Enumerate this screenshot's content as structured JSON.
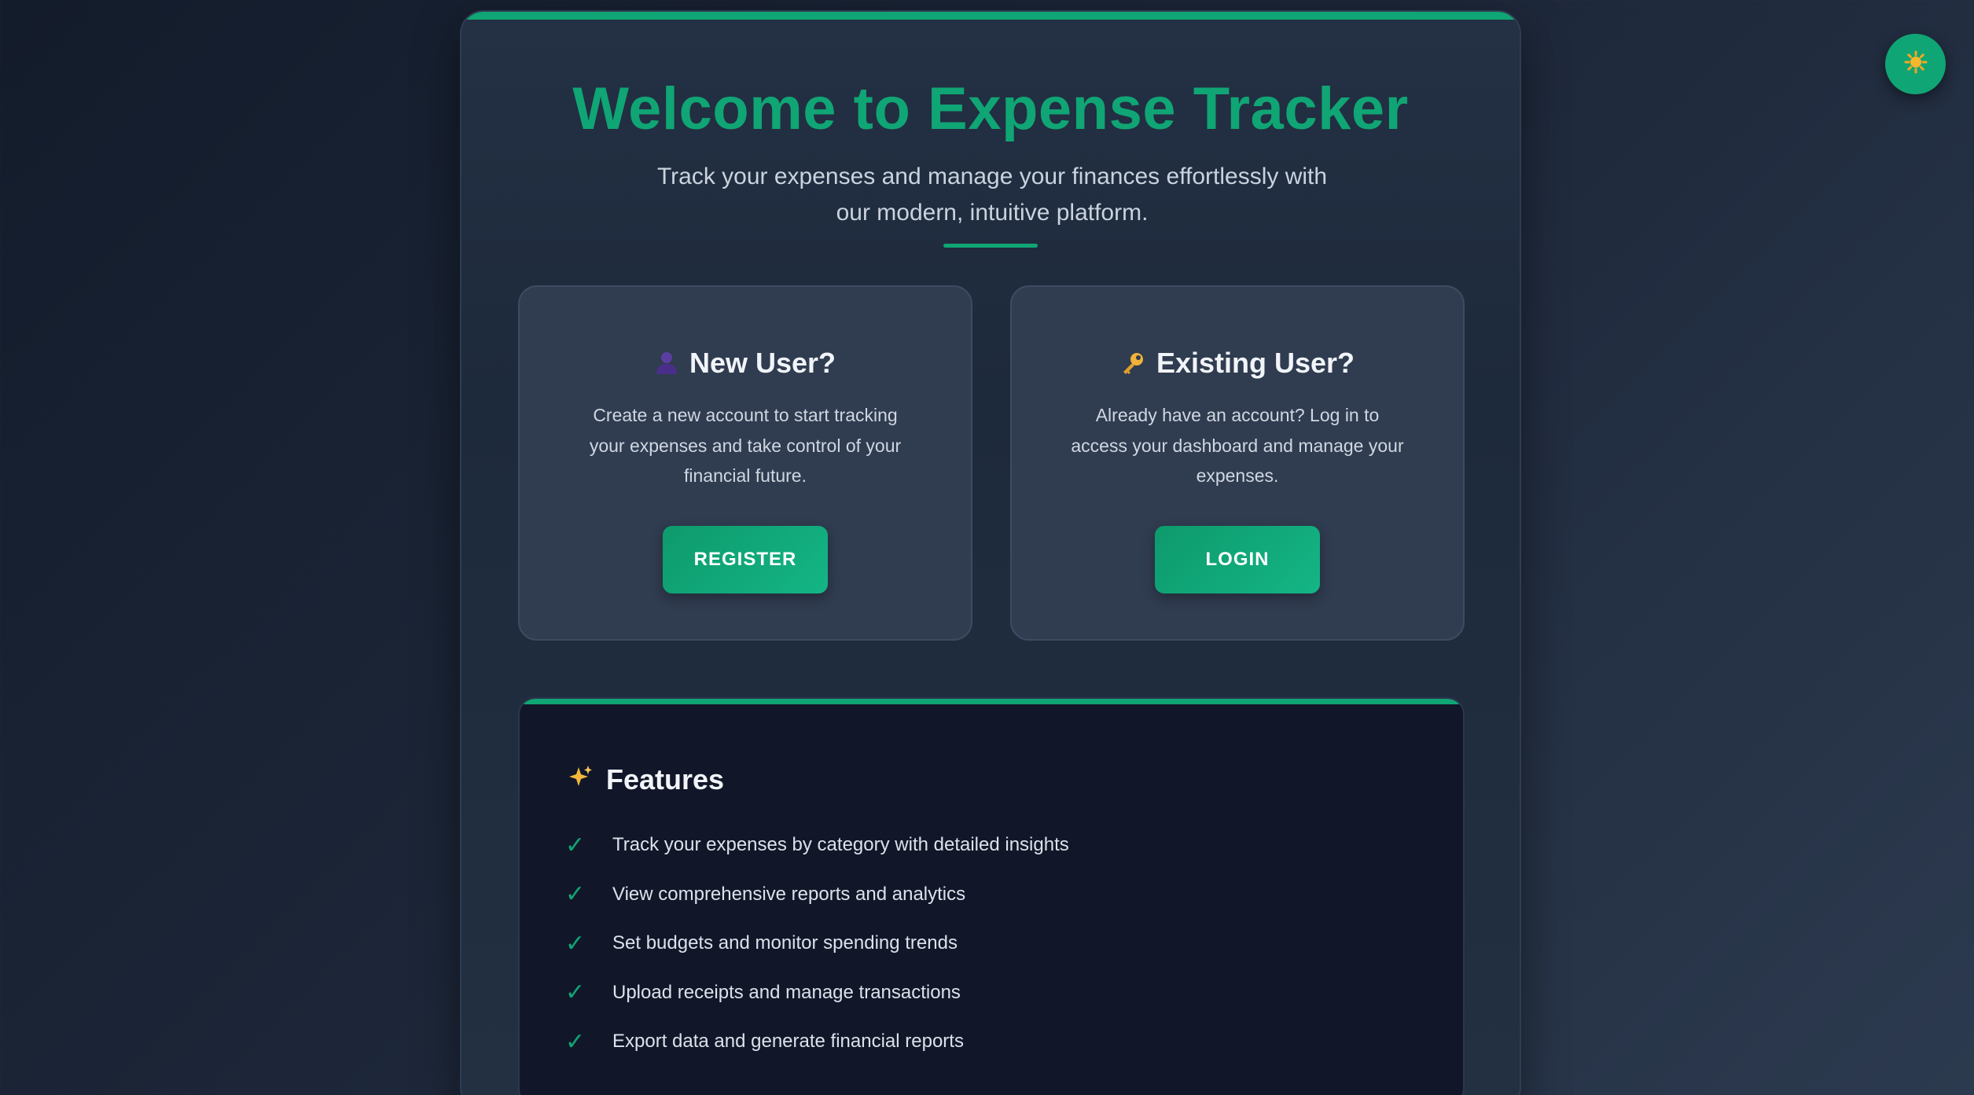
{
  "page": {
    "title": "Welcome to Expense Tracker",
    "subtitle": "Track your expenses and manage your finances effortlessly with our modern, intuitive platform."
  },
  "theme_toggle": {
    "icon": "sun-icon"
  },
  "new_user": {
    "icon": "user-icon",
    "heading": "New User?",
    "description": "Create a new account to start tracking your expenses and take control of your financial future.",
    "button_label": "REGISTER"
  },
  "existing_user": {
    "icon": "key-icon",
    "heading": "Existing User?",
    "description": "Already have an account? Log in to access your dashboard and manage your expenses.",
    "button_label": "LOGIN"
  },
  "features": {
    "icon": "sparkles-icon",
    "heading": "Features",
    "check_icon": "checkmark-icon",
    "items": [
      "Track your expenses by category with detailed insights",
      "View comprehensive reports and analytics",
      "Set budgets and monitor spending trends",
      "Upload receipts and manage transactions",
      "Export data and generate financial reports"
    ]
  },
  "colors": {
    "accent": "#10a574",
    "background": "#1c2638",
    "card": "#303c50",
    "features_panel": "#111729"
  }
}
